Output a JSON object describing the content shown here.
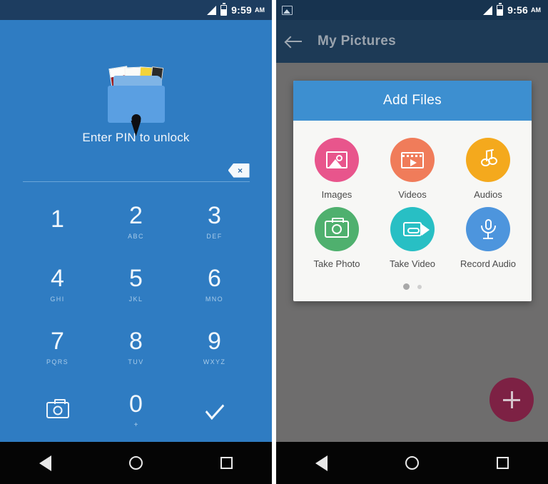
{
  "left_screen": {
    "status_bar": {
      "time": "9:59",
      "ampm": "AM",
      "signal_icon": "signal-bars-icon",
      "battery_icon": "battery-icon"
    },
    "lock": {
      "app_icon": "locked-photo-folder-icon",
      "prompt": "Enter PIN to unlock",
      "backspace_label": "×",
      "keys": [
        {
          "num": "1",
          "sub": ""
        },
        {
          "num": "2",
          "sub": "ABC"
        },
        {
          "num": "3",
          "sub": "DEF"
        },
        {
          "num": "4",
          "sub": "GHI"
        },
        {
          "num": "5",
          "sub": "JKL"
        },
        {
          "num": "6",
          "sub": "MNO"
        },
        {
          "num": "7",
          "sub": "PQRS"
        },
        {
          "num": "8",
          "sub": "TUV"
        },
        {
          "num": "9",
          "sub": "WXYZ"
        }
      ],
      "camera_key": "camera-icon",
      "zero_key": {
        "num": "0",
        "sub": "+"
      },
      "confirm_key": "checkmark-icon"
    },
    "nav_bar": {
      "back": "back-triangle-icon",
      "home": "home-circle-icon",
      "recents": "recents-square-icon"
    }
  },
  "right_screen": {
    "status_bar": {
      "time": "9:56",
      "ampm": "AM",
      "notification_icon": "gallery-icon",
      "signal_icon": "signal-bars-icon",
      "battery_icon": "battery-icon"
    },
    "app_bar": {
      "back_icon": "back-arrow-icon",
      "title": "My Pictures"
    },
    "dialog": {
      "title": "Add Files",
      "tiles": [
        {
          "label": "Images",
          "icon": "image-icon",
          "color": "#e8558c"
        },
        {
          "label": "Videos",
          "icon": "film-icon",
          "color": "#f07c5a"
        },
        {
          "label": "Audios",
          "icon": "music-note-icon",
          "color": "#f4a91d"
        },
        {
          "label": "Take Photo",
          "icon": "camera-icon",
          "color": "#4fb06e"
        },
        {
          "label": "Take Video",
          "icon": "camcorder-icon",
          "color": "#28bfc4"
        },
        {
          "label": "Record Audio",
          "icon": "microphone-icon",
          "color": "#4d95dd"
        }
      ],
      "pager": {
        "pages": 2,
        "active": 1
      }
    },
    "fab": {
      "icon": "plus-icon",
      "color": "#7d2144"
    },
    "nav_bar": {
      "back": "back-triangle-icon",
      "home": "home-circle-icon",
      "recents": "recents-square-icon"
    }
  }
}
